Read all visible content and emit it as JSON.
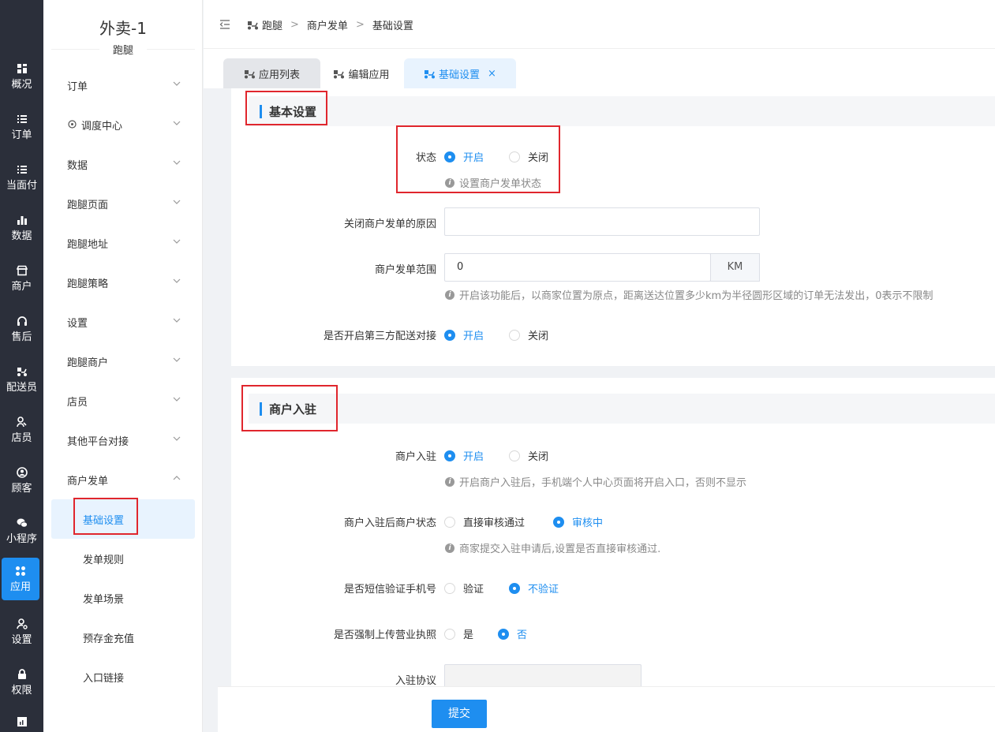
{
  "rail": {
    "items": [
      {
        "label": "概况",
        "icon": "dashboard-icon"
      },
      {
        "label": "订单",
        "icon": "list-icon"
      },
      {
        "label": "当面付",
        "icon": "list-icon"
      },
      {
        "label": "数据",
        "icon": "bar-chart-icon"
      },
      {
        "label": "商户",
        "icon": "store-icon"
      },
      {
        "label": "售后",
        "icon": "headset-icon"
      },
      {
        "label": "配送员",
        "icon": "scooter-icon"
      },
      {
        "label": "店员",
        "icon": "users-icon"
      },
      {
        "label": "顾客",
        "icon": "user-circle-icon"
      },
      {
        "label": "小程序",
        "icon": "wechat-icon"
      },
      {
        "label": "应用",
        "icon": "apps-icon"
      },
      {
        "label": "设置",
        "icon": "user-settings-icon"
      },
      {
        "label": "权限",
        "icon": "lock-icon"
      }
    ],
    "active": "应用"
  },
  "sidebar": {
    "title": "外卖-1",
    "subtitle": "跑腿",
    "menu": [
      "订单",
      "调度中心",
      "数据",
      "跑腿页面",
      "跑腿地址",
      "跑腿策略",
      "设置",
      "跑腿商户",
      "店员",
      "其他平台对接",
      "商户发单"
    ],
    "submenu": [
      "基础设置",
      "发单规则",
      "发单场景",
      "预存金充值",
      "入口链接"
    ],
    "active_sub": "基础设置"
  },
  "breadcrumb": [
    "跑腿",
    "商户发单",
    "基础设置"
  ],
  "tabs": [
    {
      "label": "应用列表"
    },
    {
      "label": "编辑应用"
    },
    {
      "label": "基础设置",
      "close": "×"
    }
  ],
  "basic": {
    "title": "基本设置",
    "status_label": "状态",
    "on": "开启",
    "off": "关闭",
    "status_hint": "设置商户发单状态",
    "close_reason_label": "关闭商户发单的原因",
    "close_reason_value": "",
    "range_label": "商户发单范围",
    "range_value": "0",
    "range_unit": "KM",
    "range_hint": "开启该功能后，以商家位置为原点，距离送达位置多少km为半径圆形区域的订单无法发出，0表示不限制",
    "third_party_label": "是否开启第三方配送对接"
  },
  "entry": {
    "title": "商户入驻",
    "entry_label": "商户入驻",
    "entry_hint": "开启商户入驻后，手机端个人中心页面将开启入口，否则不显示",
    "after_label": "商户入驻后商户状态",
    "after_opt1": "直接审核通过",
    "after_opt2": "审核中",
    "after_hint": "商家提交入驻申请后,设置是否直接审核通过.",
    "sms_label": "是否短信验证手机号",
    "sms_opt1": "验证",
    "sms_opt2": "不验证",
    "license_label": "是否强制上传营业执照",
    "license_opt1": "是",
    "license_opt2": "否",
    "agreement_label": "入驻协议"
  },
  "submit": "提交",
  "colors": {
    "accent": "#1e8ef0",
    "rail": "#2b2f3a",
    "highlight": "#e0262d"
  }
}
